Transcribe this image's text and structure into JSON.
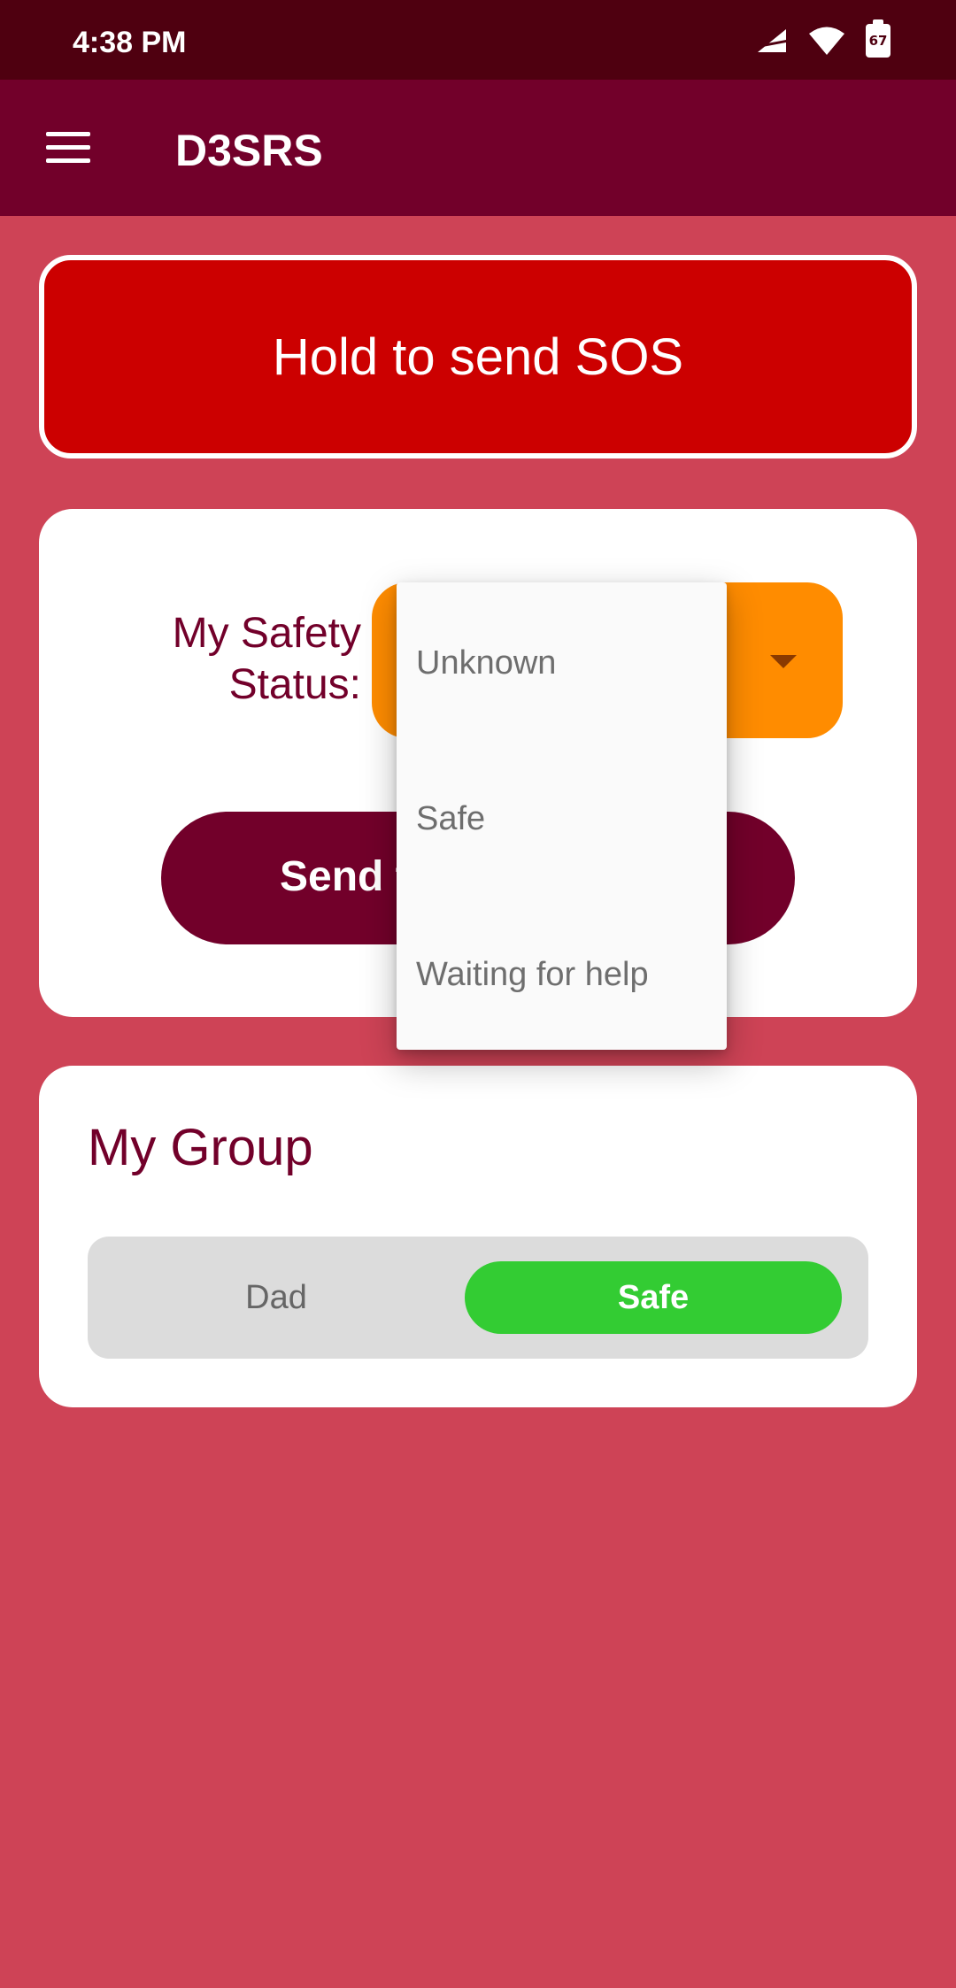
{
  "status_bar": {
    "time": "4:38 PM",
    "battery_level": "67",
    "icons": [
      "signal-icon",
      "wifi-icon",
      "battery-icon"
    ]
  },
  "app_bar": {
    "title": "D3SRS",
    "menu_icon": "menu-icon"
  },
  "sos": {
    "label": "Hold to send SOS"
  },
  "safety": {
    "label": "My Safety Status:",
    "dropdown_icon": "dropdown-arrow-icon",
    "send_label": "Send to",
    "options": [
      "Unknown",
      "Safe",
      "Waiting for help"
    ]
  },
  "group": {
    "title": "My Group",
    "members": [
      {
        "name": "Dad",
        "status": "Safe"
      }
    ]
  },
  "colors": {
    "background": "#CE4356",
    "status_bar": "#4F0010",
    "app_bar": "#72002A",
    "sos_red": "#CC0000",
    "status_orange": "#FF8C00",
    "safe_green": "#33CC33"
  }
}
